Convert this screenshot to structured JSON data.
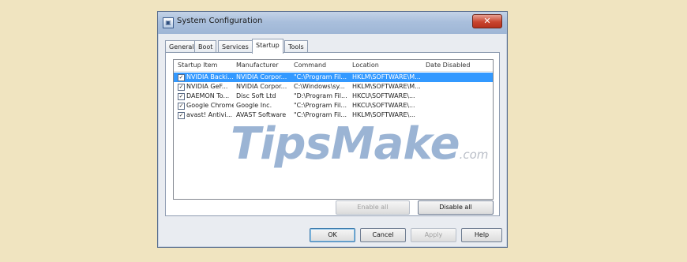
{
  "window": {
    "title": "System Configuration",
    "close": "✕"
  },
  "tabs": [
    {
      "label": "General"
    },
    {
      "label": "Boot"
    },
    {
      "label": "Services"
    },
    {
      "label": "Startup"
    },
    {
      "label": "Tools"
    }
  ],
  "startup": {
    "columns": [
      "Startup Item",
      "Manufacturer",
      "Command",
      "Location",
      "Date Disabled"
    ],
    "rows": [
      {
        "checked": "✓",
        "item": "NVIDIA Backi...",
        "manufacturer": "NVIDIA Corpor...",
        "command": "\"C:\\Program Fil...",
        "location": "HKLM\\SOFTWARE\\M...",
        "date": ""
      },
      {
        "checked": "✓",
        "item": "NVIDIA GeF...",
        "manufacturer": "NVIDIA Corpor...",
        "command": "C:\\Windows\\sy...",
        "location": "HKLM\\SOFTWARE\\M...",
        "date": ""
      },
      {
        "checked": "✓",
        "item": "DAEMON To...",
        "manufacturer": "Disc Soft Ltd",
        "command": "\"D:\\Program Fil...",
        "location": "HKCU\\SOFTWARE\\...",
        "date": ""
      },
      {
        "checked": "✓",
        "item": "Google Chrome",
        "manufacturer": "Google Inc.",
        "command": "\"C:\\Program Fil...",
        "location": "HKCU\\SOFTWARE\\...",
        "date": ""
      },
      {
        "checked": "✓",
        "item": "avast! Antivi...",
        "manufacturer": "AVAST Software",
        "command": "\"C:\\Program Fil...",
        "location": "HKLM\\SOFTWARE\\...",
        "date": ""
      }
    ],
    "enable_all": "Enable all",
    "disable_all": "Disable all"
  },
  "footer": {
    "ok": "OK",
    "cancel": "Cancel",
    "apply": "Apply",
    "help": "Help"
  },
  "watermark": {
    "main": "TipsMake",
    "suffix": ".com"
  }
}
